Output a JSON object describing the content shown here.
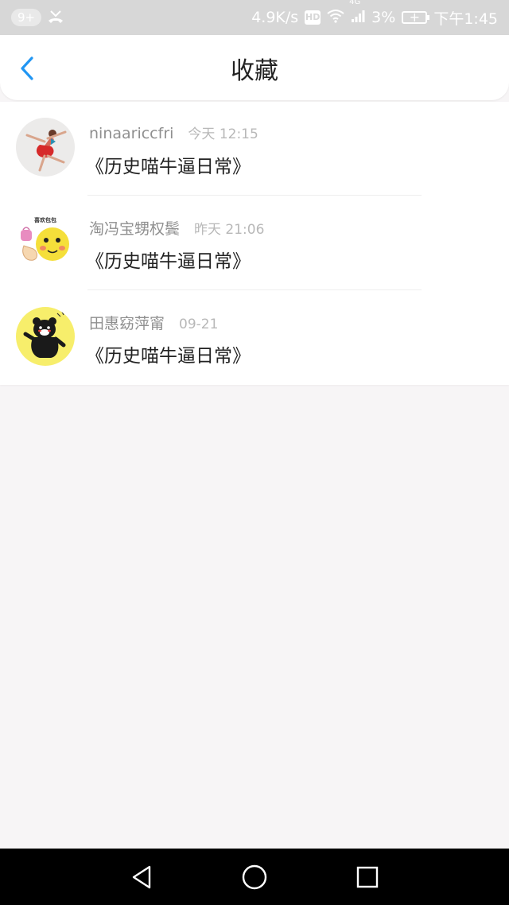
{
  "status_bar": {
    "notification_badge": "9+",
    "network_speed": "4.9K/s",
    "hd_label": "HD",
    "network_type": "4G",
    "battery": "3%",
    "time": "下午1:45",
    "icons": [
      "missed-call-icon",
      "hd-icon",
      "wifi-icon",
      "signal-icon",
      "battery-charging-icon"
    ]
  },
  "header": {
    "title": "收藏",
    "back_icon": "chevron-left-icon",
    "accent_color": "#2196f3"
  },
  "favorites": [
    {
      "username": "ninaariccfri",
      "time": "今天 12:15",
      "post_title": "《历史喵牛逼日常》",
      "avatar": "dancer-avatar"
    },
    {
      "username": "淘冯宝甥权鬓",
      "time": "昨天 21:06",
      "post_title": "《历史喵牛逼日常》",
      "avatar": "emoji-sticker-avatar",
      "avatar_text": "喜欢包包"
    },
    {
      "username": "田惠窈萍甯",
      "time": "09-21",
      "post_title": "《历史喵牛逼日常》",
      "avatar": "bear-avatar"
    }
  ],
  "nav_bar": {
    "icons": [
      "back-triangle-icon",
      "home-circle-icon",
      "recents-square-icon"
    ]
  }
}
